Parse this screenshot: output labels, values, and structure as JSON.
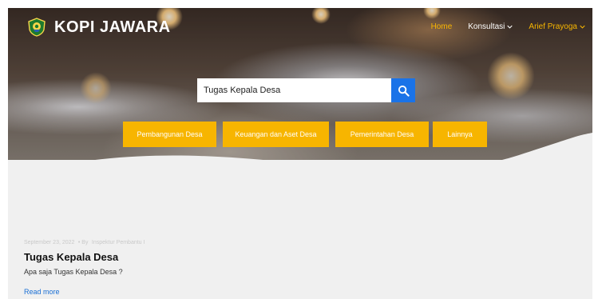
{
  "brand": {
    "name": "KOPI JAWARA",
    "logo_icon": "regency-emblem-icon"
  },
  "nav": {
    "home": "Home",
    "konsultasi": "Konsultasi",
    "user": "Arief Prayoga"
  },
  "search": {
    "value": "Tugas Kepala Desa",
    "button_icon": "search-icon"
  },
  "categories": [
    "Pembangunan Desa",
    "Keuangan dan Aset Desa",
    "Pemerintahan Desa",
    "Lainnya"
  ],
  "post": {
    "date": "September 23, 2022",
    "separator": "• By",
    "author": "Inspektur Pembantu I",
    "title": "Tugas Kepala Desa",
    "excerpt": "Apa saja Tugas Kepala Desa ?",
    "read_more": "Read more"
  },
  "colors": {
    "accent": "#f7b500",
    "primary": "#1a73e8",
    "link": "#1a6fd4",
    "content_bg": "#f0f0f0"
  }
}
